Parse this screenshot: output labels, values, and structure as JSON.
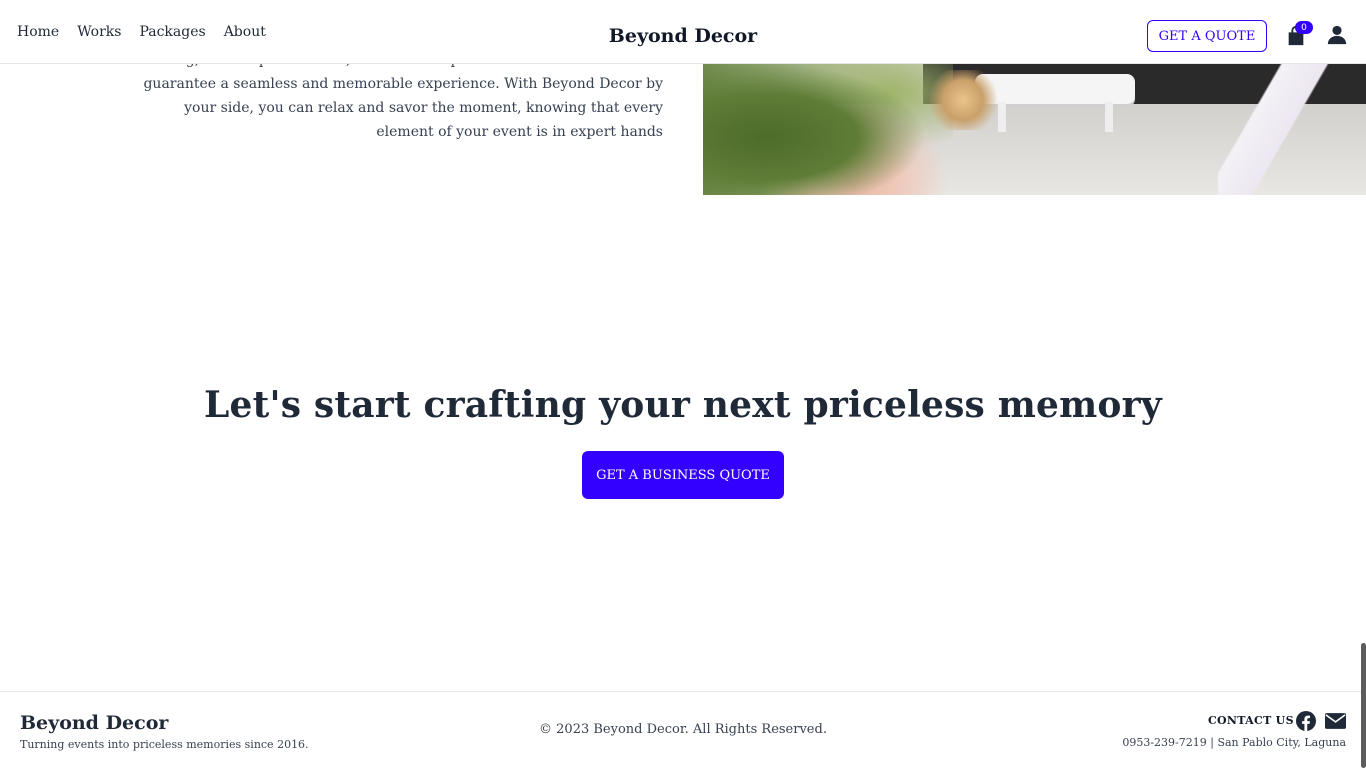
{
  "header": {
    "nav": [
      {
        "label": "Home"
      },
      {
        "label": "Works"
      },
      {
        "label": "Packages"
      },
      {
        "label": "About"
      }
    ],
    "brand": "Beyond Decor",
    "quote_button": "GET A QUOTE",
    "cart_count": "0"
  },
  "intro": {
    "lines": [
      "wedding, or a corporate affair, our team's expertise and attention to detail",
      "guarantee a seamless and memorable experience. With Beyond Decor by",
      "your side, you can relax and savor the moment, knowing that every",
      "element of your event is in expert hands"
    ]
  },
  "cta": {
    "title": "Let's start crafting your next priceless memory",
    "button": "GET A BUSINESS QUOTE"
  },
  "footer": {
    "brand": "Beyond Decor",
    "tagline": "Turning events into priceless memories since 2016.",
    "copyright": "© 2023 Beyond Decor. All Rights Reserved.",
    "contact_label": "CONTACT US",
    "contact_info": "0953-239-7219 | San Pablo City, Laguna"
  },
  "colors": {
    "accent": "#3300ff",
    "text": "#1f2937"
  },
  "icons": [
    "shopping-bag-icon",
    "user-icon",
    "facebook-icon",
    "envelope-icon"
  ]
}
